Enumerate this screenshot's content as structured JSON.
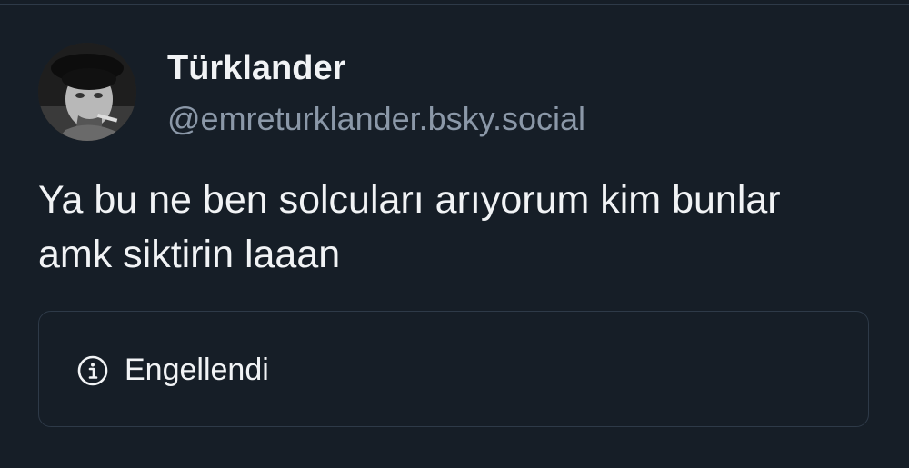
{
  "post": {
    "author": {
      "display_name": "Türklander",
      "handle": "@emreturklander.bsky.social",
      "avatar_icon": "user-avatar-photo"
    },
    "text": "Ya bu ne ben solcuları arıyorum kim bunlar amk siktirin laaan",
    "embed": {
      "icon": "info-icon",
      "label": "Engellendi"
    }
  },
  "colors": {
    "background": "#161e27",
    "text_primary": "#f1f3f5",
    "text_secondary": "#8b98a8",
    "border": "#2e3a48"
  }
}
